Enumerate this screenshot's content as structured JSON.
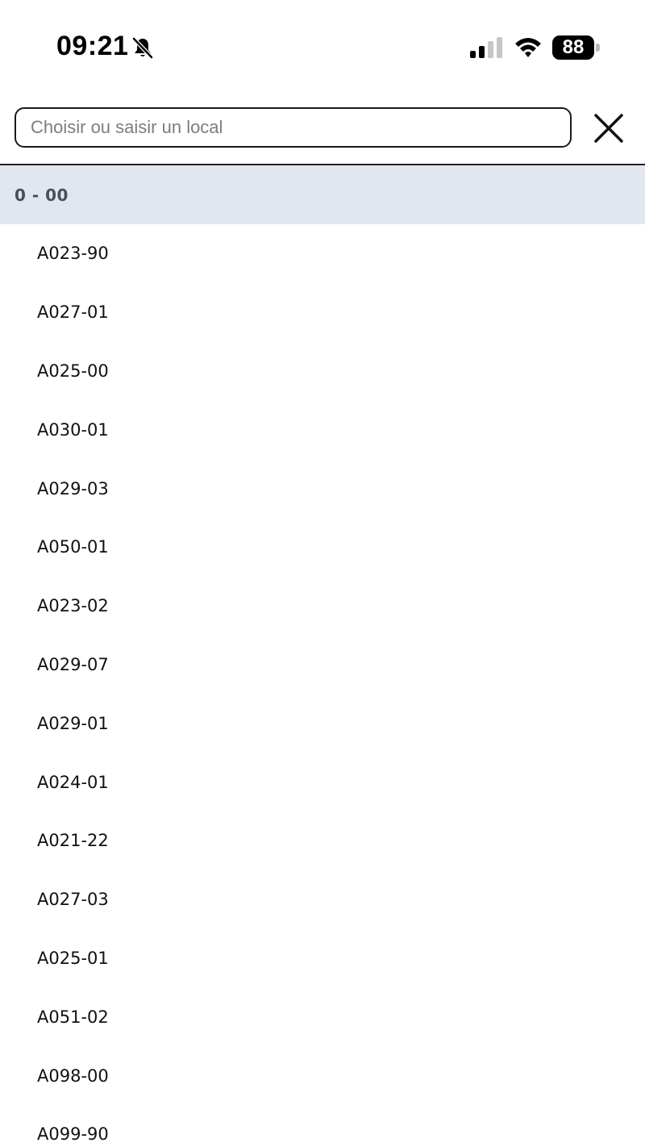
{
  "status_bar": {
    "time": "09:21",
    "battery_level": "88",
    "silent_mode_icon": "bell-slash-icon",
    "signal_bars_active": 2,
    "signal_bars_total": 4
  },
  "search": {
    "placeholder": "Choisir ou saisir un local",
    "value": "",
    "close_icon": "close-icon"
  },
  "list": {
    "group_label": "0 - 00",
    "items": [
      "A023-90",
      "A027-01",
      "A025-00",
      "A030-01",
      "A029-03",
      "A050-01",
      "A023-02",
      "A029-07",
      "A029-01",
      "A024-01",
      "A021-22",
      "A027-03",
      "A025-01",
      "A051-02",
      "A098-00",
      "A099-90"
    ]
  },
  "colors": {
    "group_header_bg": "#e2e7ef",
    "group_header_text": "#4a4e57",
    "border": "#1a1a1a",
    "placeholder": "#7d7d7d"
  }
}
